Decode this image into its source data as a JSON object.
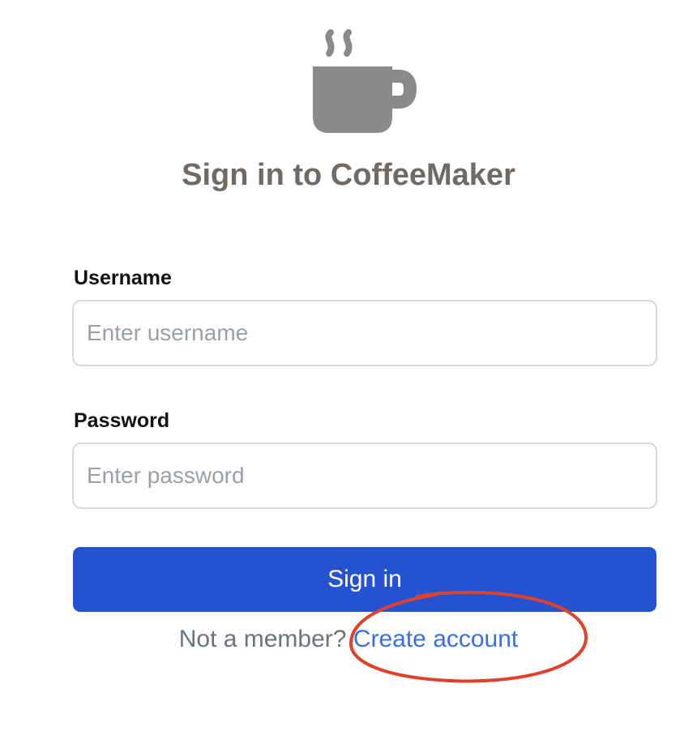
{
  "app": {
    "logo_icon": "coffee-cup-icon",
    "title": "Sign in to CoffeeMaker"
  },
  "form": {
    "username": {
      "label": "Username",
      "placeholder": "Enter username",
      "value": ""
    },
    "password": {
      "label": "Password",
      "placeholder": "Enter password",
      "value": ""
    },
    "submit_label": "Sign in"
  },
  "footer": {
    "prompt": "Not a member?",
    "link_label": "Create account"
  },
  "annotation": {
    "shape": "circle-highlight",
    "target": "create-account-link",
    "color": "#e0412c"
  },
  "colors": {
    "primary": "#2452d1",
    "link": "#3b6fe0",
    "icon": "#8a8a8a",
    "title": "#6f6a66"
  }
}
